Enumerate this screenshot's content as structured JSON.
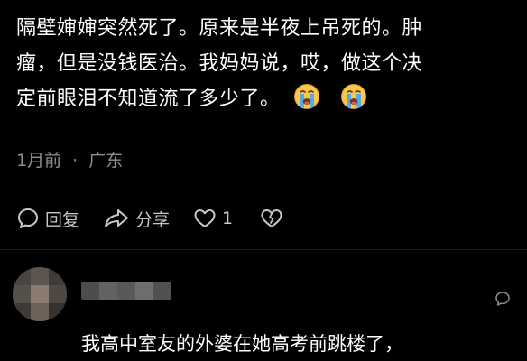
{
  "comment": {
    "line1": "隔壁婶婶突然死了。原来是半夜上吊死的。肿",
    "line2": "瘤，但是没钱医治。我妈妈说，哎，做这个决",
    "line3": "定前眼泪不知道流了多少了。",
    "emojis": [
      "loudly-crying-face-icon",
      "loudly-crying-face-icon"
    ],
    "time": "1月前",
    "separator": "·",
    "location": "广东"
  },
  "actions": {
    "reply_label": "回复",
    "share_label": "分享",
    "like_count": "1",
    "icons": [
      "comment-bubble-icon",
      "share-arrow-icon",
      "heart-icon",
      "broken-heart-icon"
    ]
  },
  "reply": {
    "text": "我高中室友的外婆在她高考前跳楼了，",
    "avatar_icon": "blurred-avatar",
    "username_icon": "blurred-username",
    "more_icon": "chat-bubble-icon"
  },
  "colors": {
    "background": "#000000",
    "text": "#ffffff",
    "meta_text": "#8e8e8e",
    "action_text": "#c8c8c8",
    "emoji_face": "#f9c74f",
    "emoji_tears": "#4fa8e8"
  }
}
